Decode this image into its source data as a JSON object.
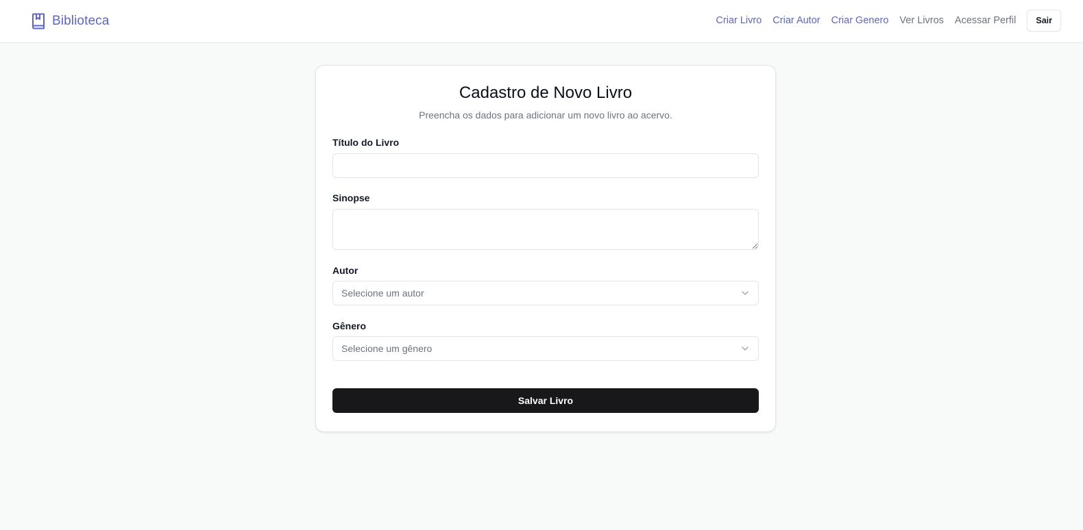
{
  "brand": {
    "name": "Biblioteca",
    "icon": "book-bookmark-icon",
    "color": "#5b63d8"
  },
  "nav": {
    "links": [
      {
        "label": "Criar Livro",
        "style": "accent"
      },
      {
        "label": "Criar Autor",
        "style": "accent"
      },
      {
        "label": "Criar Genero",
        "style": "accent"
      },
      {
        "label": "Ver Livros",
        "style": "muted"
      },
      {
        "label": "Acessar Perfil",
        "style": "muted"
      }
    ],
    "logout_label": "Sair"
  },
  "form": {
    "title": "Cadastro de Novo Livro",
    "subtitle": "Preencha os dados para adicionar um novo livro ao acervo.",
    "title_field": {
      "label": "Título do Livro",
      "value": ""
    },
    "synopsis_field": {
      "label": "Sinopse",
      "value": ""
    },
    "author_field": {
      "label": "Autor",
      "selected": "Selecione um autor",
      "icon": "chevron-down-icon"
    },
    "genre_field": {
      "label": "Gênero",
      "selected": "Selecione um gênero",
      "icon": "chevron-down-icon"
    },
    "submit_label": "Salvar Livro"
  },
  "colors": {
    "accent": "#5b63d8",
    "muted": "#6b7280",
    "primary_button": "#18181b",
    "background": "#f8f9f9"
  }
}
